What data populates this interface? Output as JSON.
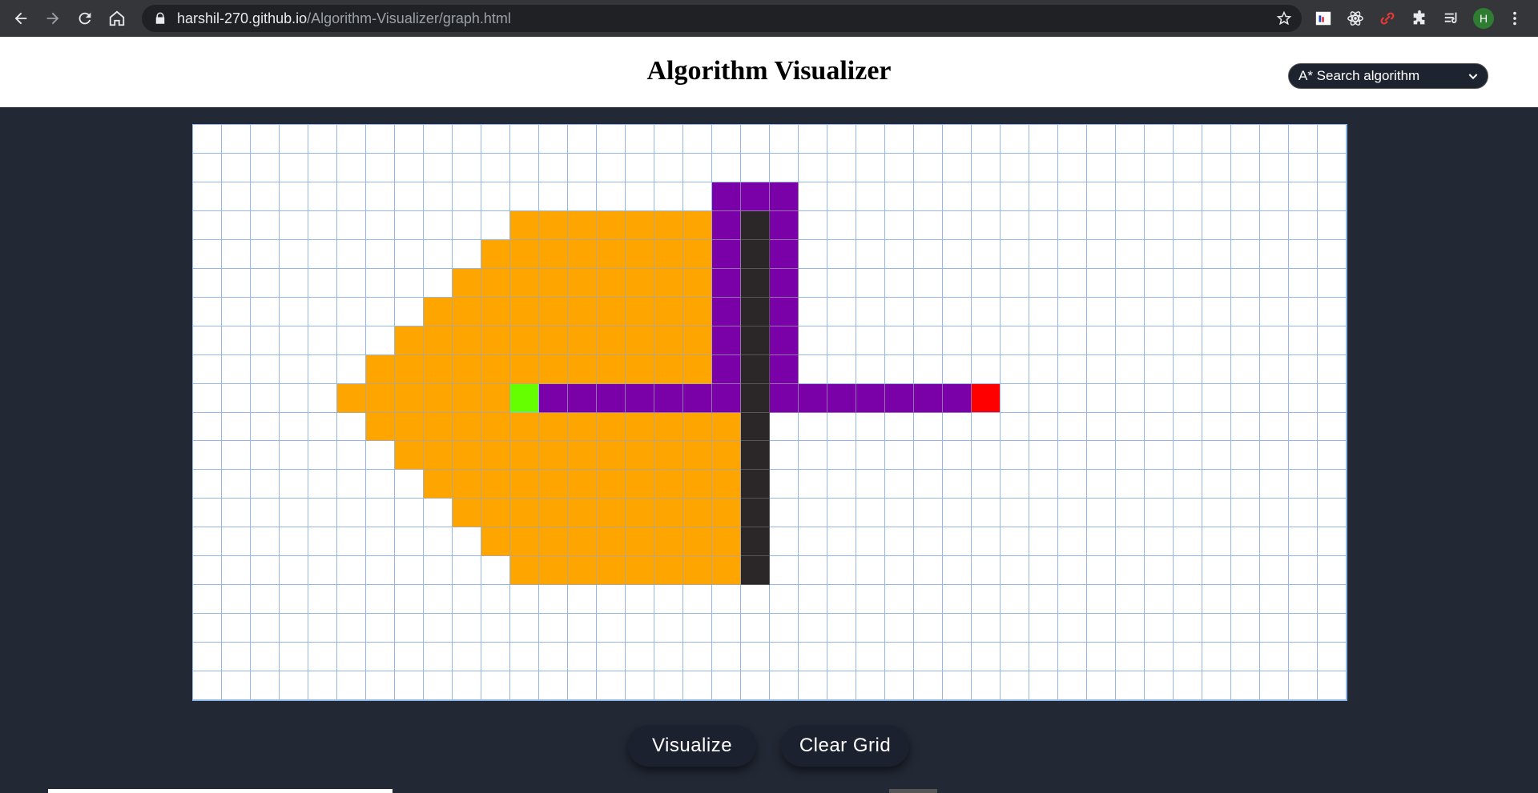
{
  "browser": {
    "url_host": "harshil-270.github.io",
    "url_path": "/Algorithm-Visualizer/graph.html",
    "profile_initial": "H"
  },
  "header": {
    "title": "Algorithm Visualizer",
    "algorithm_selected": "A* Search algorithm"
  },
  "grid": {
    "rows": 20,
    "cols": 40,
    "start": [
      9,
      11
    ],
    "end": [
      9,
      27
    ],
    "walls": [
      [
        3,
        19
      ],
      [
        4,
        19
      ],
      [
        5,
        19
      ],
      [
        6,
        19
      ],
      [
        7,
        19
      ],
      [
        8,
        19
      ],
      [
        9,
        19
      ],
      [
        10,
        19
      ],
      [
        11,
        19
      ],
      [
        12,
        19
      ],
      [
        13,
        19
      ],
      [
        14,
        19
      ],
      [
        15,
        19
      ]
    ],
    "path": [
      [
        2,
        18
      ],
      [
        2,
        19
      ],
      [
        2,
        20
      ],
      [
        3,
        18
      ],
      [
        3,
        20
      ],
      [
        4,
        18
      ],
      [
        4,
        20
      ],
      [
        5,
        18
      ],
      [
        5,
        20
      ],
      [
        6,
        18
      ],
      [
        6,
        20
      ],
      [
        7,
        18
      ],
      [
        7,
        20
      ],
      [
        8,
        18
      ],
      [
        8,
        20
      ],
      [
        9,
        12
      ],
      [
        9,
        13
      ],
      [
        9,
        14
      ],
      [
        9,
        15
      ],
      [
        9,
        16
      ],
      [
        9,
        17
      ],
      [
        9,
        18
      ],
      [
        9,
        20
      ],
      [
        9,
        21
      ],
      [
        9,
        22
      ],
      [
        9,
        23
      ],
      [
        9,
        24
      ],
      [
        9,
        25
      ],
      [
        9,
        26
      ]
    ],
    "visited_ranges": [
      [
        3,
        11,
        17
      ],
      [
        4,
        10,
        17
      ],
      [
        5,
        9,
        17
      ],
      [
        6,
        8,
        17
      ],
      [
        7,
        7,
        17
      ],
      [
        8,
        6,
        17
      ],
      [
        9,
        5,
        10
      ],
      [
        10,
        6,
        18
      ],
      [
        11,
        7,
        18
      ],
      [
        12,
        8,
        18
      ],
      [
        13,
        9,
        18
      ],
      [
        14,
        10,
        18
      ],
      [
        15,
        11,
        18
      ]
    ]
  },
  "controls": {
    "visualize_label": "Visualize",
    "clear_label": "Clear Grid"
  },
  "colors": {
    "visited": "#ffa500",
    "path": "#7a00a8",
    "wall": "#2b2628",
    "start": "#66ff00",
    "end": "#ff0000",
    "background": "#222834"
  }
}
